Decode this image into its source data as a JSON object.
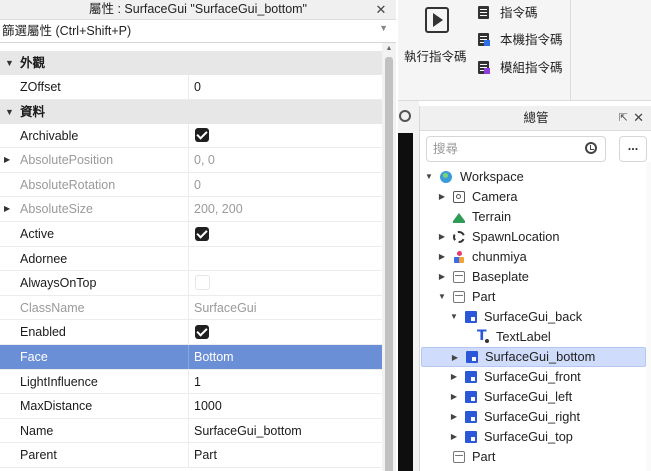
{
  "props": {
    "title": "屬性 : SurfaceGui \"SurfaceGui_bottom\"",
    "close": "✕",
    "filter_placeholder": "篩選屬性 (Ctrl+Shift+P)",
    "sections": {
      "appearance": {
        "label": "外觀",
        "rows": [
          {
            "name": "ZOffset",
            "value": "0"
          }
        ]
      },
      "data": {
        "label": "資料",
        "rows": [
          {
            "name": "Archivable",
            "value": "checked"
          },
          {
            "name": "AbsolutePosition",
            "value": "0, 0"
          },
          {
            "name": "AbsoluteRotation",
            "value": "0"
          },
          {
            "name": "AbsoluteSize",
            "value": "200, 200"
          },
          {
            "name": "Active",
            "value": "checked"
          },
          {
            "name": "Adornee",
            "value": ""
          },
          {
            "name": "AlwaysOnTop",
            "value": "unchecked"
          },
          {
            "name": "ClassName",
            "value": "SurfaceGui"
          },
          {
            "name": "Enabled",
            "value": "checked"
          },
          {
            "name": "Face",
            "value": "Bottom"
          },
          {
            "name": "LightInfluence",
            "value": "1"
          },
          {
            "name": "MaxDistance",
            "value": "1000"
          },
          {
            "name": "Name",
            "value": "SurfaceGui_bottom"
          },
          {
            "name": "Parent",
            "value": "Part"
          }
        ]
      }
    }
  },
  "ribbon": {
    "run_label": "執行指令碼",
    "items": [
      {
        "label": "指令碼"
      },
      {
        "label": "本機指令碼"
      },
      {
        "label": "模組指令碼"
      }
    ]
  },
  "explorer": {
    "title": "總管",
    "pop_icon": "⇱",
    "close": "✕",
    "search_placeholder": "搜尋",
    "more": "...",
    "tree": [
      {
        "label": "Workspace"
      },
      {
        "label": "Camera"
      },
      {
        "label": "Terrain"
      },
      {
        "label": "SpawnLocation"
      },
      {
        "label": "chunmiya"
      },
      {
        "label": "Baseplate"
      },
      {
        "label": "Part"
      },
      {
        "label": "SurfaceGui_back"
      },
      {
        "label": "TextLabel"
      },
      {
        "label": "SurfaceGui_bottom"
      },
      {
        "label": "SurfaceGui_front"
      },
      {
        "label": "SurfaceGui_left"
      },
      {
        "label": "SurfaceGui_right"
      },
      {
        "label": "SurfaceGui_top"
      },
      {
        "label": "Part"
      }
    ]
  },
  "colors": {
    "selection_blue": "#6b8fd6",
    "tree_selection": "#cfdcfb",
    "gui_icon": "#2b58d8"
  }
}
